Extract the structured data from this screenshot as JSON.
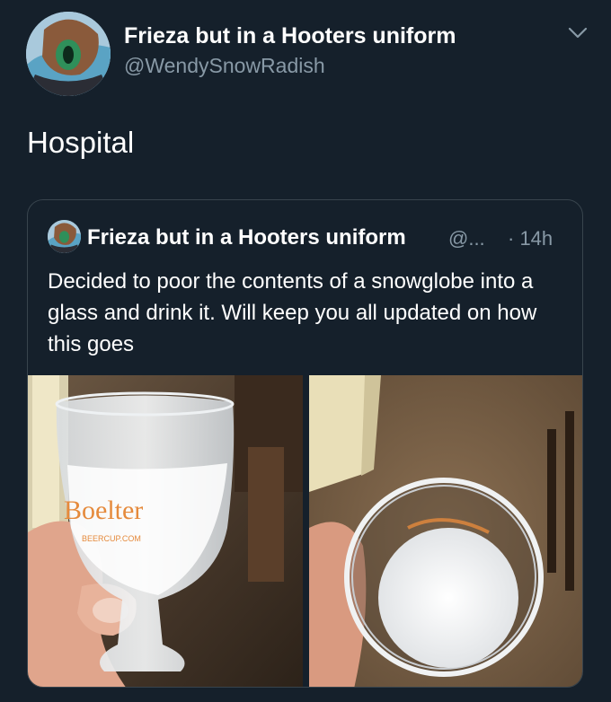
{
  "tweet": {
    "author_name": "Frieza but in a Hooters uniform",
    "handle": "@WendySnowRadish",
    "text": "Hospital",
    "avatar_icon": "avatar-icon",
    "menu_icon": "chevron-down-icon"
  },
  "quoted_tweet": {
    "author_name": "Frieza but in a Hooters uniform",
    "handle": "@...",
    "time": "· 14h",
    "text": "Decided to poor the contents of a snowglobe into a glass and drink it. Will keep you all updated on how this goes",
    "photos": [
      {
        "glass_brand_text": "Boelter",
        "glass_url_text": "BEERCUP.COM"
      },
      {
        "glass_brand_text": ""
      }
    ]
  },
  "colors": {
    "background": "#15202b",
    "secondary_text": "#8899a6",
    "card_border": "#38444d"
  }
}
